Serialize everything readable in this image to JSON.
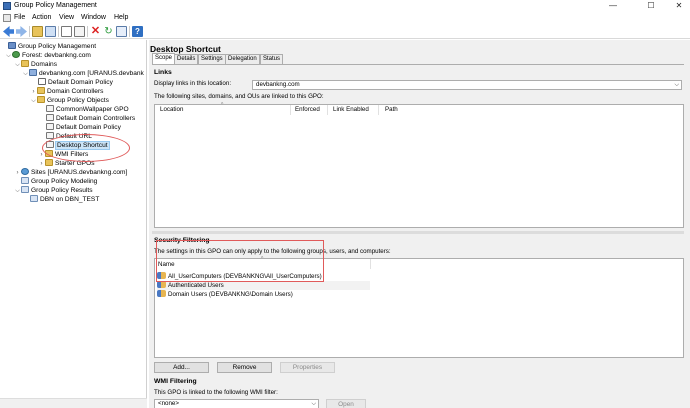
{
  "window": {
    "title": "Group Policy Management",
    "controls": {
      "minimize": "—",
      "maximize": "☐",
      "close": "✕"
    }
  },
  "menu": [
    "File",
    "Action",
    "View",
    "Window",
    "Help"
  ],
  "tree": {
    "root": "Group Policy Management",
    "forest": "Forest: devbankng.com",
    "domains": "Domains",
    "domain": "devbankng.com [URANUS.devbank",
    "default_domain_policy": "Default Domain Policy",
    "domain_controllers": "Domain Controllers",
    "gpo_folder": "Group Policy Objects",
    "gpos": [
      "CommonWallpaper GPO",
      "Default Domain Controllers",
      "Default Domain Policy",
      "Default URL",
      "Desktop Shortcut"
    ],
    "wmi_filters": "WMI Filters",
    "starter_gpos": "Starter GPOs",
    "sites": "Sites [URANUS.devbankng.com]",
    "modeling": "Group Policy Modeling",
    "results": "Group Policy Results",
    "result_item": "DBN on DBN_TEST"
  },
  "details": {
    "title": "Desktop Shortcut",
    "tabs": [
      "Scope",
      "Details",
      "Settings",
      "Delegation",
      "Status"
    ],
    "links": {
      "heading": "Links",
      "display_label": "Display links in this location:",
      "location_value": "devbankng.com",
      "list_caption": "The following sites, domains, and OUs are linked to this GPO:",
      "columns": [
        "Location",
        "Enforced",
        "Link Enabled",
        "Path"
      ]
    },
    "security": {
      "heading": "Security Filtering",
      "caption": "The settings in this GPO can only apply to the following groups, users, and computers:",
      "column": "Name",
      "rows": [
        "All_UserComputers (DEVBANKNG\\All_UserComputers)",
        "Authenticated Users",
        "Domain Users (DEVBANKNG\\Domain Users)"
      ],
      "buttons": {
        "add": "Add...",
        "remove": "Remove",
        "properties": "Properties"
      }
    },
    "wmi": {
      "heading": "WMI Filtering",
      "caption": "This GPO is linked to the following WMI filter:",
      "value": "<none>",
      "open": "Open"
    }
  },
  "colors": {
    "annotation": "#e05a5a",
    "selection": "#cce4f7"
  }
}
